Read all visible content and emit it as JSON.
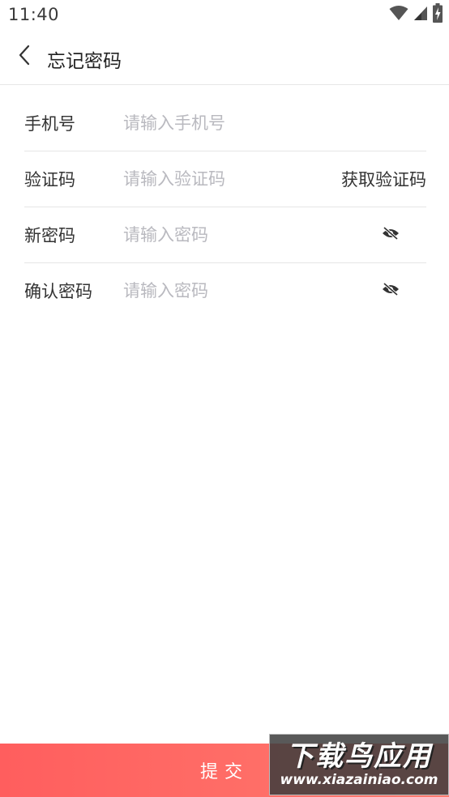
{
  "status_bar": {
    "time": "11:40",
    "icons": [
      "wifi-icon",
      "cellular-signal-icon",
      "battery-charging-icon"
    ]
  },
  "header": {
    "back_icon": "chevron-left-icon",
    "title": "忘记密码"
  },
  "form": {
    "phone": {
      "label": "手机号",
      "value": "",
      "placeholder": "请输入手机号"
    },
    "code": {
      "label": "验证码",
      "value": "",
      "placeholder": "请输入验证码",
      "get_code_label": "获取验证码"
    },
    "new_password": {
      "label": "新密码",
      "value": "",
      "placeholder": "请输入密码",
      "toggle_icon": "eye-off-icon"
    },
    "confirm_password": {
      "label": "确认密码",
      "value": "",
      "placeholder": "请输入密码",
      "toggle_icon": "eye-off-icon"
    }
  },
  "submit": {
    "label": "提交"
  },
  "watermark": {
    "title": "下载鸟应用",
    "url": "www.xiazainiao.com"
  },
  "colors": {
    "accent_start": "#ff5e5e",
    "accent_end": "#ff7a6e",
    "placeholder": "#b9b9bf",
    "divider": "#e6e6e6"
  }
}
